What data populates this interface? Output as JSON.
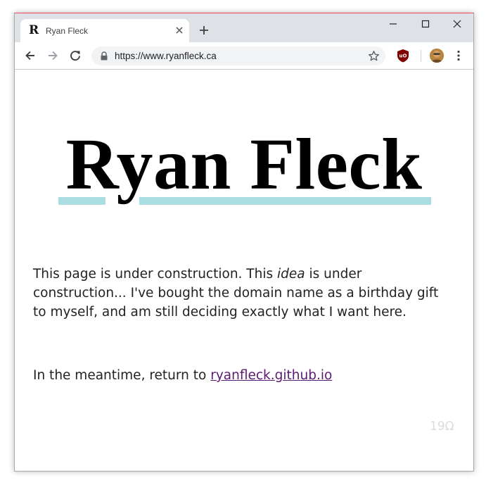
{
  "browser": {
    "tab": {
      "title": "Ryan Fleck",
      "favicon": "R"
    },
    "url": "https://www.ryanfleck.ca"
  },
  "page": {
    "title": "Ryan Fleck",
    "para1_before": "This page is under construction. This ",
    "para1_em": "idea",
    "para1_after": " is under construction... I've bought the domain name as a birthday gift to myself, and am still deciding exactly what I want here.",
    "para2_before": "In the meantime, return to ",
    "para2_link": "ryanfleck.github.io",
    "footer_mark": "19Ω"
  },
  "colors": {
    "title_underline": "#a9dde2",
    "link": "#5a1a72",
    "window_accent": "#e8495f"
  }
}
